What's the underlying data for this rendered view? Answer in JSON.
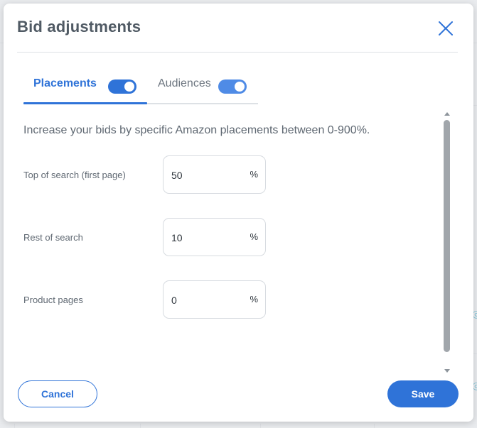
{
  "modal": {
    "title": "Bid adjustments",
    "close_icon": "close-icon"
  },
  "tabs": [
    {
      "label": "Placements",
      "active": true,
      "toggle_on": true
    },
    {
      "label": "Audiences",
      "active": false,
      "toggle_on": true
    }
  ],
  "placements": {
    "intro": "Increase your bids by specific Amazon placements between 0-900%.",
    "rows": [
      {
        "label": "Top of search (first page)",
        "value": "50",
        "unit": "%"
      },
      {
        "label": "Rest of search",
        "value": "10",
        "unit": "%"
      },
      {
        "label": "Product pages",
        "value": "0",
        "unit": "%"
      }
    ]
  },
  "footer": {
    "cancel_label": "Cancel",
    "save_label": "Save"
  },
  "colors": {
    "accent": "#2f73d8",
    "text": "#5f6872",
    "title": "#505a64"
  }
}
